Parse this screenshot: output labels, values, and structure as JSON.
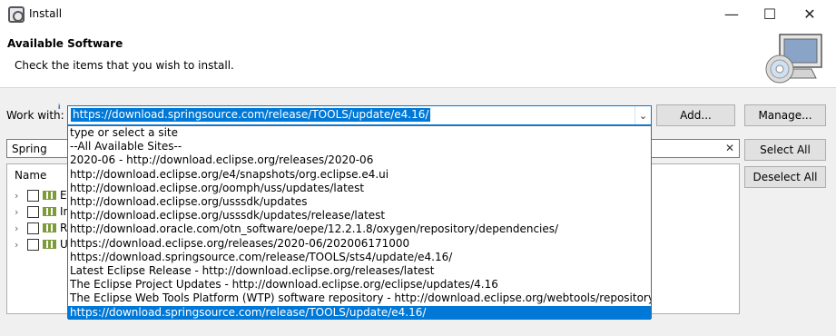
{
  "window": {
    "title": "Install",
    "minimize": "—",
    "maximize": "☐",
    "close": "✕"
  },
  "header": {
    "title": "Available Software",
    "description": "Check the items that you wish to install."
  },
  "work_with": {
    "label": "Work with:",
    "value": "https://download.springsource.com/release/TOOLS/update/e4.16/",
    "add_label": "Add...",
    "manage_label": "Manage..."
  },
  "filter": {
    "value": "Spring"
  },
  "buttons": {
    "select_all": "Select All",
    "deselect_all": "Deselect All"
  },
  "tree": {
    "column": "Name",
    "rows": [
      {
        "label": "E"
      },
      {
        "label": "In"
      },
      {
        "label": "R"
      },
      {
        "label": "U"
      }
    ]
  },
  "dropdown": {
    "options": [
      "type or select a site",
      "--All Available Sites--",
      "2020-06 - http://download.eclipse.org/releases/2020-06",
      "http://download.eclipse.org/e4/snapshots/org.eclipse.e4.ui",
      "http://download.eclipse.org/oomph/uss/updates/latest",
      "http://download.eclipse.org/usssdk/updates",
      "http://download.eclipse.org/usssdk/updates/release/latest",
      "http://download.oracle.com/otn_software/oepe/12.2.1.8/oxygen/repository/dependencies/",
      "https://download.eclipse.org/releases/2020-06/202006171000",
      "https://download.springsource.com/release/TOOLS/sts4/update/e4.16/",
      "Latest Eclipse Release - http://download.eclipse.org/releases/latest",
      "The Eclipse Project Updates - http://download.eclipse.org/eclipse/updates/4.16",
      "The Eclipse Web Tools Platform (WTP) software repository - http://download.eclipse.org/webtools/repository/latest",
      "https://download.springsource.com/release/TOOLS/update/e4.16/"
    ],
    "selected_index": 13
  }
}
